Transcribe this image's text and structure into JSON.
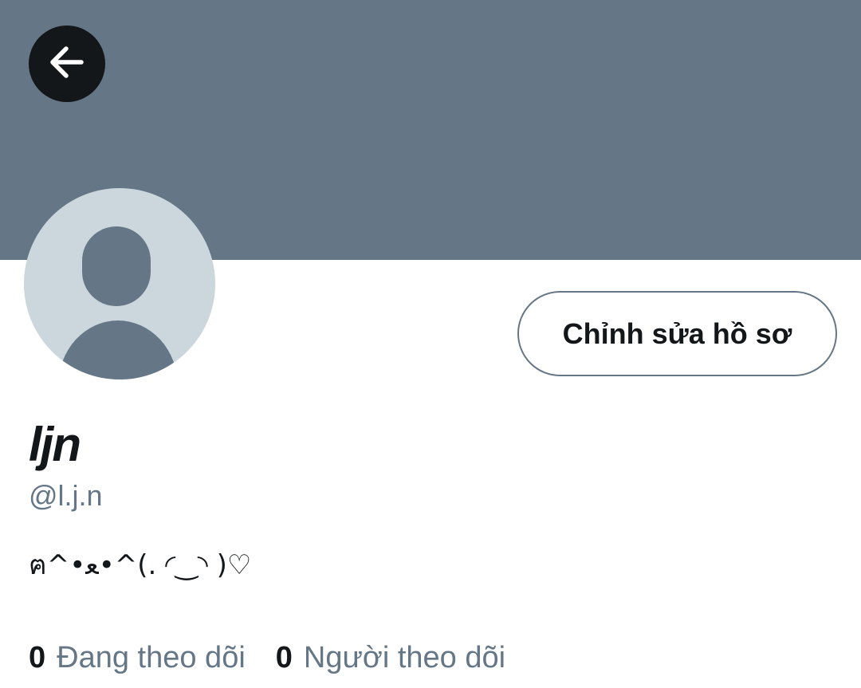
{
  "header": {
    "back_icon": "arrow-left-icon",
    "banner_color": "#657786"
  },
  "profile": {
    "avatar_icon": "default-avatar-icon",
    "edit_button_label": "Chỉnh sửa hồ sơ",
    "display_name": "ljn",
    "handle": "@l.j.n",
    "bio": "ฅ^•ﻌ•^(. ◜‿◝ )♡"
  },
  "stats": {
    "following_count": "0",
    "following_label": "Đang theo dõi",
    "followers_count": "0",
    "followers_label": "Người theo dõi"
  },
  "colors": {
    "text_primary": "#14171a",
    "text_secondary": "#657786",
    "avatar_bg": "#ccd6dd"
  }
}
